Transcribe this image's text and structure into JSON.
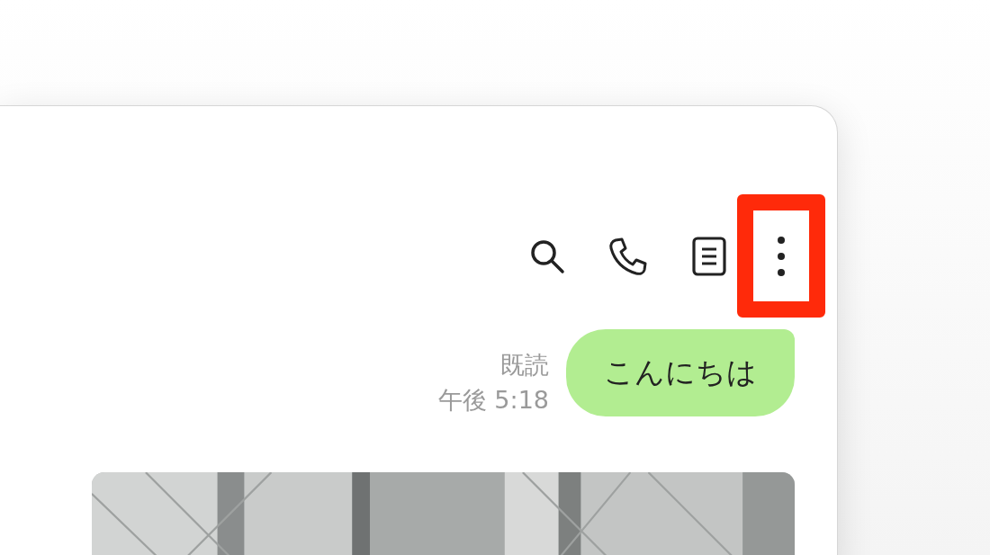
{
  "toolbar": [
    {
      "kind": "search",
      "highlighted": false
    },
    {
      "kind": "call",
      "highlighted": false
    },
    {
      "kind": "notes",
      "highlighted": false
    },
    {
      "kind": "more",
      "highlighted": true
    }
  ],
  "messages": [
    {
      "kind": "text",
      "read_label": "既読",
      "time": "午後 5:18",
      "text": "こんにちは"
    },
    {
      "kind": "picture"
    }
  ]
}
